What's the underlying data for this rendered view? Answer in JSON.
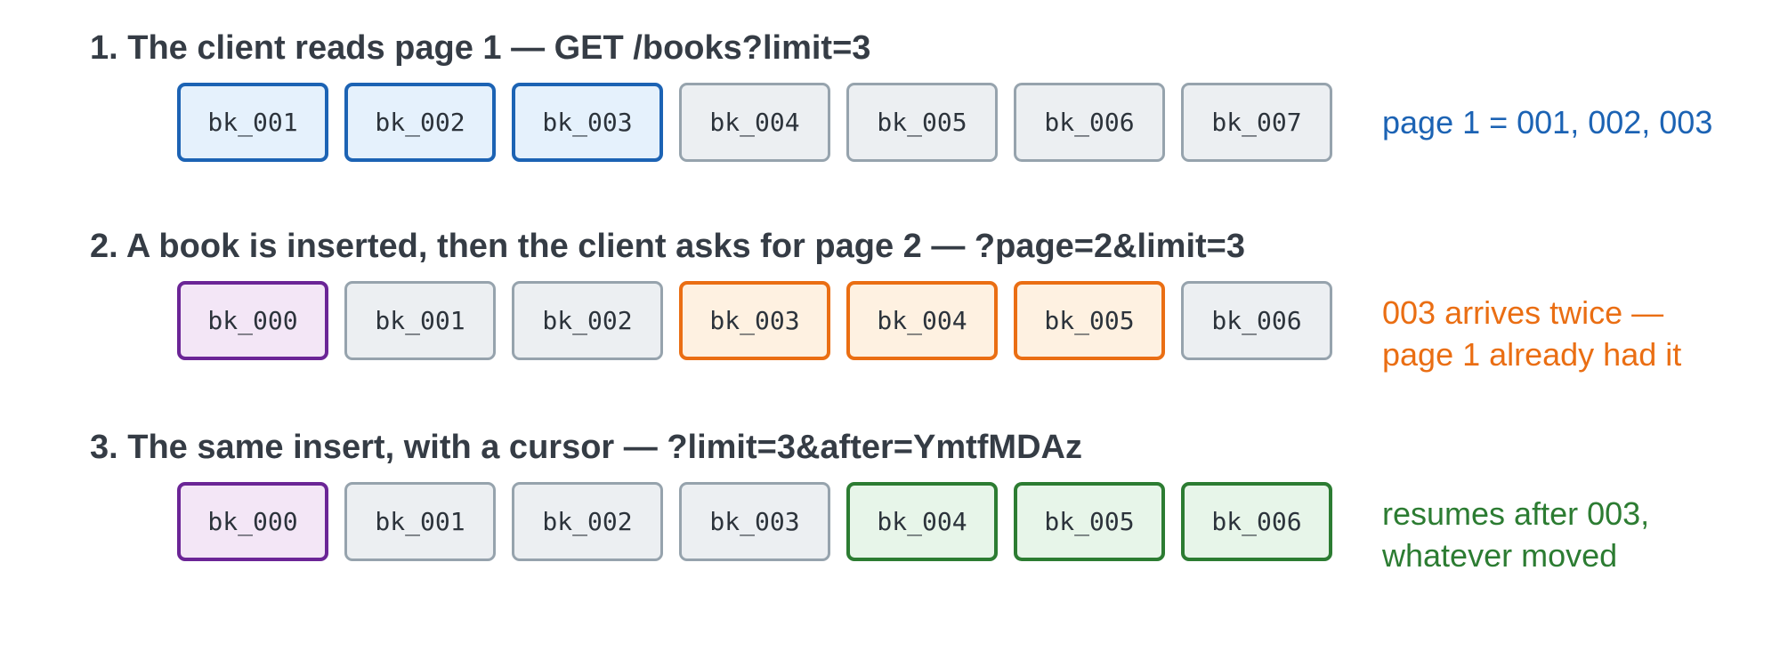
{
  "colors": {
    "heading": "#353c45",
    "neutral_border": "#96a3ad",
    "neutral_fill": "#eceff2",
    "page1_blue": "#1c63b4",
    "inserted_purple": "#6b2596",
    "duplicate_orange": "#ea6e13",
    "cursor_green": "#2c7c32"
  },
  "sections": [
    {
      "heading": "1. The client reads page 1 — GET /books?limit=3",
      "items": [
        {
          "label": "bk_001",
          "style": "blue"
        },
        {
          "label": "bk_002",
          "style": "blue"
        },
        {
          "label": "bk_003",
          "style": "blue"
        },
        {
          "label": "bk_004",
          "style": "plain"
        },
        {
          "label": "bk_005",
          "style": "plain"
        },
        {
          "label": "bk_006",
          "style": "plain"
        },
        {
          "label": "bk_007",
          "style": "plain"
        }
      ],
      "note": [
        "page 1 = 001, 002, 003"
      ],
      "note_color": "#1c63b4"
    },
    {
      "heading": "2. A book is inserted, then the client asks for page 2 — ?page=2&limit=3",
      "items": [
        {
          "label": "bk_000",
          "style": "purple"
        },
        {
          "label": "bk_001",
          "style": "plain"
        },
        {
          "label": "bk_002",
          "style": "plain"
        },
        {
          "label": "bk_003",
          "style": "orange"
        },
        {
          "label": "bk_004",
          "style": "orange"
        },
        {
          "label": "bk_005",
          "style": "orange"
        },
        {
          "label": "bk_006",
          "style": "plain"
        }
      ],
      "note": [
        "003 arrives twice —",
        "page 1 already had it"
      ],
      "note_color": "#ea6e13"
    },
    {
      "heading": "3. The same insert, with a cursor — ?limit=3&after=YmtfMDAz",
      "items": [
        {
          "label": "bk_000",
          "style": "purple"
        },
        {
          "label": "bk_001",
          "style": "plain"
        },
        {
          "label": "bk_002",
          "style": "plain"
        },
        {
          "label": "bk_003",
          "style": "plain"
        },
        {
          "label": "bk_004",
          "style": "green"
        },
        {
          "label": "bk_005",
          "style": "green"
        },
        {
          "label": "bk_006",
          "style": "green"
        }
      ],
      "note": [
        "resumes after 003,",
        "whatever moved"
      ],
      "note_color": "#2c7c32"
    }
  ]
}
